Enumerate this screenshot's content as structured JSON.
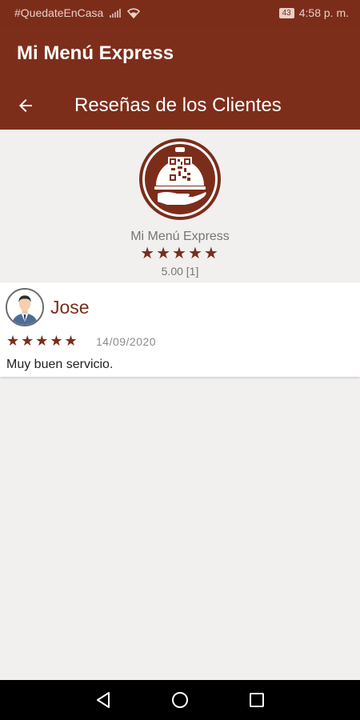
{
  "status_bar": {
    "hashtag": "#QuedateEnCasa",
    "battery": "43",
    "time": "4:58 p. m."
  },
  "app": {
    "title": "Mi Menú Express"
  },
  "toolbar": {
    "title": "Reseñas de los Clientes"
  },
  "restaurant": {
    "name": "Mi Menú Express",
    "stars": "★★★★★",
    "rating_text": "5.00 [1]"
  },
  "reviews": [
    {
      "name": "Jose",
      "stars": "★★★★★",
      "date": "14/09/2020",
      "text": "Muy buen servicio."
    }
  ],
  "icons": {
    "back": "arrow-back-icon",
    "nav_back": "triangle-back-icon",
    "nav_home": "circle-home-icon",
    "nav_recents": "square-recents-icon"
  },
  "colors": {
    "primary": "#7d2e1b",
    "accent": "#7b2d1a",
    "background": "#f2efef"
  }
}
